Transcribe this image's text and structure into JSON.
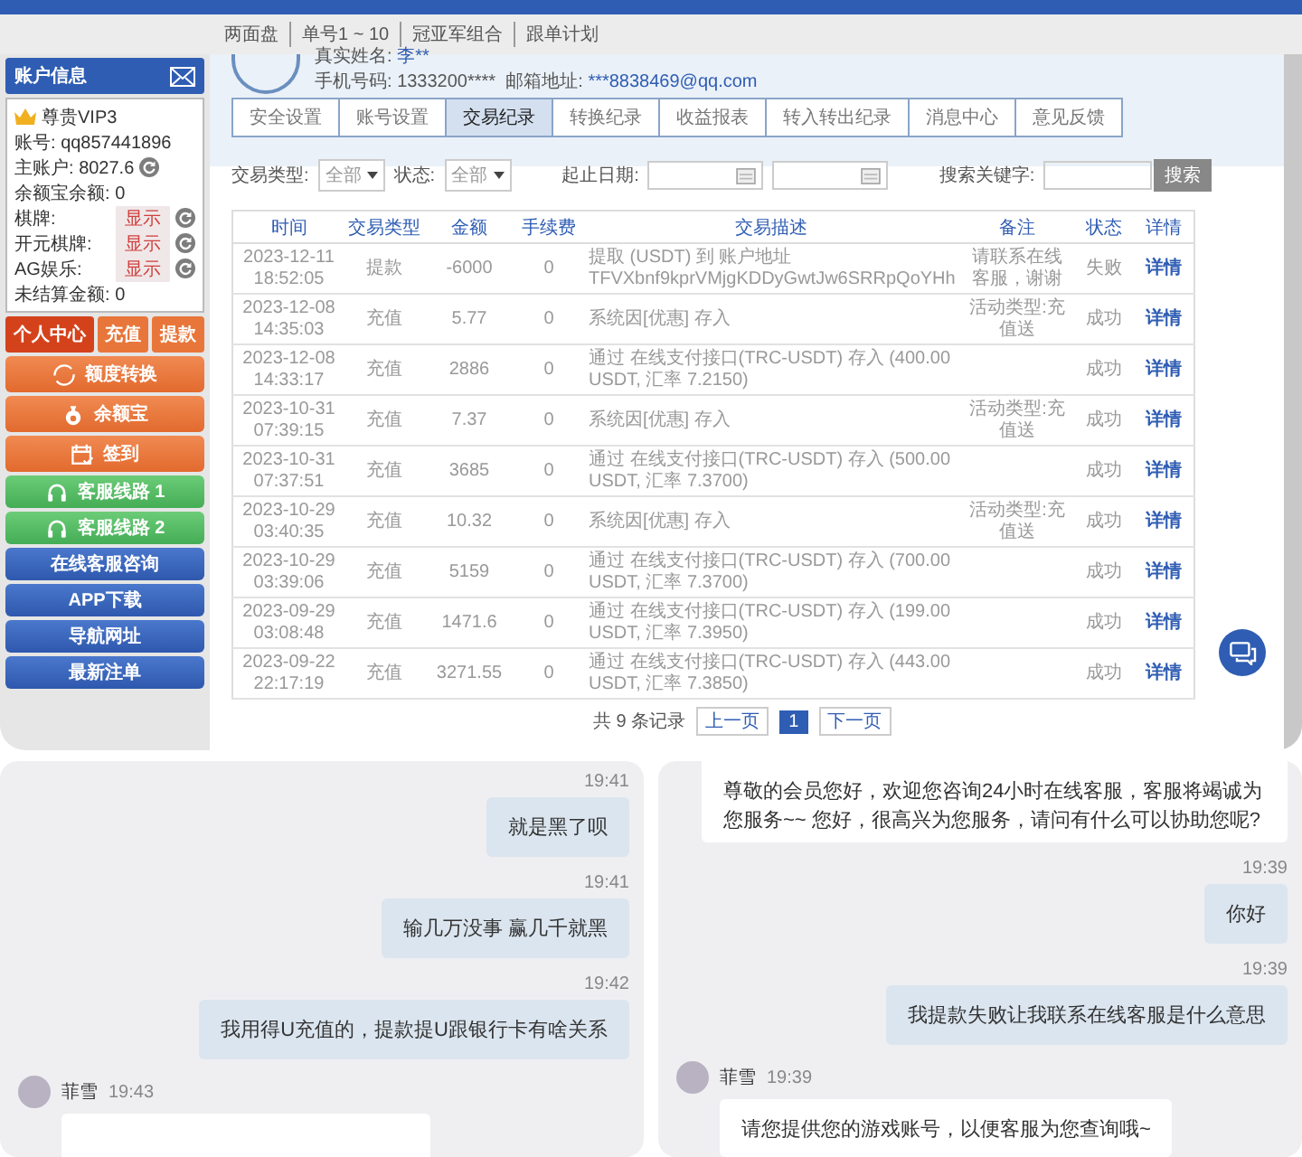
{
  "top_nav": {
    "items": [
      "两面盘",
      "单号1 ~ 10",
      "冠亚军组合",
      "跟单计划"
    ]
  },
  "account_panel": {
    "title": "账户信息",
    "vip": "尊贵VIP3",
    "fields": [
      {
        "label": "账号:",
        "value": "qq857441896",
        "kind": "text"
      },
      {
        "label": "主账户:",
        "value": "8027.6",
        "kind": "refresh"
      },
      {
        "label": "余额宝余额:",
        "value": "0",
        "kind": "text"
      },
      {
        "label": "棋牌:",
        "value": "显示",
        "kind": "toggle"
      },
      {
        "label": "开元棋牌:",
        "value": "显示",
        "kind": "toggle"
      },
      {
        "label": "AG娱乐:",
        "value": "显示",
        "kind": "toggle"
      },
      {
        "label": "未结算金额:",
        "value": "0",
        "kind": "text"
      }
    ]
  },
  "quick_tabs": [
    {
      "label": "个人中心",
      "selected": true
    },
    {
      "label": "充值",
      "selected": false
    },
    {
      "label": "提款",
      "selected": false
    }
  ],
  "menu_buttons": [
    {
      "label": "额度转换",
      "kind": "feature"
    },
    {
      "label": "余额宝",
      "kind": "feature"
    },
    {
      "label": "签到",
      "kind": "feature"
    },
    {
      "label": "客服线路 1",
      "kind": "support"
    },
    {
      "label": "客服线路 2",
      "kind": "support"
    },
    {
      "label": "在线客服咨询",
      "kind": "link"
    },
    {
      "label": "APP下载",
      "kind": "link"
    },
    {
      "label": "导航网址",
      "kind": "link"
    },
    {
      "label": "最新注单",
      "kind": "link"
    }
  ],
  "profile": {
    "real_name_label": "真实姓名:",
    "real_name": "李**",
    "phone_label": "手机号码:",
    "phone": "1333200****",
    "email_label": "邮箱地址:",
    "email": "***8838469@qq.com"
  },
  "tabs": [
    {
      "label": "安全设置",
      "selected": false
    },
    {
      "label": "账号设置",
      "selected": false
    },
    {
      "label": "交易纪录",
      "selected": true
    },
    {
      "label": "转换纪录",
      "selected": false
    },
    {
      "label": "收益报表",
      "selected": false
    },
    {
      "label": "转入转出纪录",
      "selected": false
    },
    {
      "label": "消息中心",
      "selected": false
    },
    {
      "label": "意见反馈",
      "selected": false
    }
  ],
  "filters": {
    "type_label": "交易类型:",
    "type_value": "全部",
    "status_label": "状态:",
    "status_value": "全部",
    "date_label": "起止日期:",
    "keyword_label": "搜索关键字:",
    "search_button": "搜索"
  },
  "table": {
    "columns": [
      "时间",
      "交易类型",
      "金额",
      "手续费",
      "交易描述",
      "备注",
      "状态",
      "详情"
    ],
    "rows": [
      {
        "time": "2023-12-11 18:52:05",
        "type": "提款",
        "amount": "-6000",
        "fee": "0",
        "description": "提取 (USDT) 到 账户地址 TFVXbnf9kprVMjgKDDyGwtJw6SRRpQoYHh",
        "remark": "请联系在线客服，谢谢",
        "status": "失败",
        "detail": "详情"
      },
      {
        "time": "2023-12-08 14:35:03",
        "type": "充值",
        "amount": "5.77",
        "fee": "0",
        "description": "系统因[优惠] 存入",
        "remark": "活动类型:充值送",
        "status": "成功",
        "detail": "详情"
      },
      {
        "time": "2023-12-08 14:33:17",
        "type": "充值",
        "amount": "2886",
        "fee": "0",
        "description": "通过 在线支付接口(TRC-USDT) 存入 (400.00 USDT, 汇率 7.2150)",
        "status": "成功",
        "detail": "详情"
      },
      {
        "time": "2023-10-31 07:39:15",
        "type": "充值",
        "amount": "7.37",
        "fee": "0",
        "description": "系统因[优惠] 存入",
        "remark": "活动类型:充值送",
        "status": "成功",
        "detail": "详情"
      },
      {
        "time": "2023-10-31 07:37:51",
        "type": "充值",
        "amount": "3685",
        "fee": "0",
        "description": "通过 在线支付接口(TRC-USDT) 存入 (500.00 USDT, 汇率 7.3700)",
        "status": "成功",
        "detail": "详情"
      },
      {
        "time": "2023-10-29 03:40:35",
        "type": "充值",
        "amount": "10.32",
        "fee": "0",
        "description": "系统因[优惠] 存入",
        "remark": "活动类型:充值送",
        "status": "成功",
        "detail": "详情"
      },
      {
        "time": "2023-10-29 03:39:06",
        "type": "充值",
        "amount": "5159",
        "fee": "0",
        "description": "通过 在线支付接口(TRC-USDT) 存入 (700.00 USDT, 汇率 7.3700)",
        "status": "成功",
        "detail": "详情"
      },
      {
        "time": "2023-09-29 03:08:48",
        "type": "充值",
        "amount": "1471.6",
        "fee": "0",
        "description": "通过 在线支付接口(TRC-USDT) 存入 (199.00 USDT, 汇率 7.3950)",
        "status": "成功",
        "detail": "详情"
      },
      {
        "time": "2023-09-22 22:17:19",
        "type": "充值",
        "amount": "3271.55",
        "fee": "0",
        "description": "通过 在线支付接口(TRC-USDT) 存入 (443.00 USDT, 汇率 7.3850)",
        "status": "成功",
        "detail": "详情"
      }
    ]
  },
  "pagination": {
    "summary": "共 9 条记录",
    "prev": "上一页",
    "pages": [
      {
        "label": "1",
        "selected": true
      }
    ],
    "next": "下一页"
  },
  "chats": [
    {
      "messages": [
        {
          "kind": "sent",
          "time": "19:41",
          "text": "就是黑了呗"
        },
        {
          "kind": "sent",
          "time": "19:41",
          "text": "输几万没事 赢几千就黑"
        },
        {
          "kind": "sent",
          "time": "19:42",
          "text": "我用得U充值的，提款提U跟银行卡有啥关系"
        },
        {
          "kind": "received",
          "sender": "菲雪",
          "time": "19:43"
        }
      ]
    },
    {
      "messages": [
        {
          "kind": "received",
          "text": "尊敬的会员您好，欢迎您咨询24小时在线客服，客服将竭诚为您服务~~ 您好，很高兴为您服务，请问有什么可以协助您呢?"
        },
        {
          "kind": "sent",
          "time": "19:39",
          "text": "你好"
        },
        {
          "kind": "sent",
          "time": "19:39",
          "text": "我提款失败让我联系在线客服是什么意思"
        },
        {
          "kind": "received",
          "sender": "菲雪",
          "time": "19:39",
          "text": "请您提供您的游戏账号，以便客服为您查询哦~"
        }
      ]
    }
  ]
}
